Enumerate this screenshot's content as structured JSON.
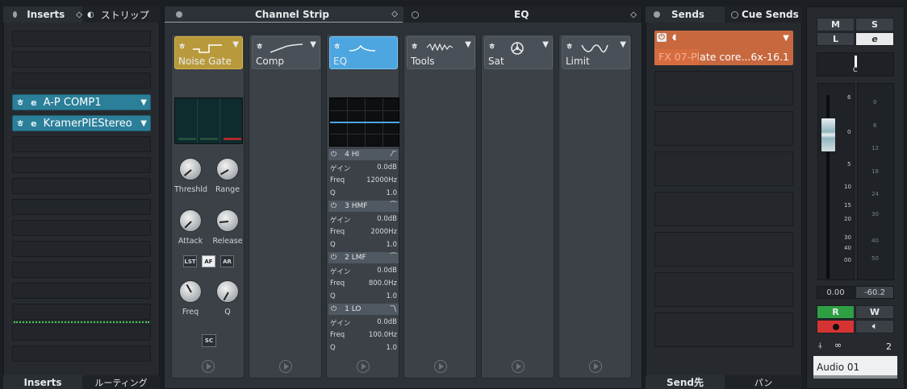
{
  "inserts": {
    "tab": "Inserts",
    "strip_tab": "ストリップ",
    "bottom_tabs": [
      "Inserts",
      "ルーティング"
    ],
    "slots": [
      {
        "label": "A-P COMP1",
        "icon": "e"
      },
      {
        "label": "KramerPIEStereo",
        "icon": "e"
      }
    ]
  },
  "channel_strip": {
    "title": "Channel Strip",
    "modules": [
      {
        "name": "Noise Gate"
      },
      {
        "name": "Comp"
      },
      {
        "name": "EQ"
      },
      {
        "name": "Tools"
      },
      {
        "name": "Sat"
      },
      {
        "name": "Limit"
      }
    ]
  },
  "eq": {
    "title": "EQ"
  },
  "gate": {
    "knobs": [
      "Threshld",
      "Range",
      "Attack",
      "Release",
      "Freq",
      "Q"
    ],
    "buttons": [
      "LST",
      "AF",
      "AR"
    ],
    "sc": "SC"
  },
  "eq_bands": [
    {
      "name": "4 HI",
      "gain_label": "ゲイン",
      "gain": "0.0dB",
      "freq_label": "Freq",
      "freq": "12000Hz",
      "q_label": "Q",
      "q": "1.0"
    },
    {
      "name": "3 HMF",
      "gain_label": "ゲイン",
      "gain": "0.0dB",
      "freq_label": "Freq",
      "freq": "2000Hz",
      "q_label": "Q",
      "q": "1.0"
    },
    {
      "name": "2 LMF",
      "gain_label": "ゲイン",
      "gain": "0.0dB",
      "freq_label": "Freq",
      "freq": "800.0Hz",
      "q_label": "Q",
      "q": "1.0"
    },
    {
      "name": "1 LO",
      "gain_label": "ゲイン",
      "gain": "0.0dB",
      "freq_label": "Freq",
      "freq": "100.0Hz",
      "q_label": "Q",
      "q": "1.0"
    }
  ],
  "sends": {
    "tab": "Sends",
    "cue_tab": "Cue Sends",
    "slot1": "FX 07-Plate core...6x",
    "slot1_level": "-16.1",
    "bottom_tabs": [
      "Send先",
      "パン"
    ]
  },
  "fader": {
    "m": "M",
    "s": "S",
    "l": "L",
    "e": "e",
    "pan": "C",
    "left_scale": [
      "6",
      "0",
      "5",
      "10",
      "15",
      "20",
      "30",
      "40",
      "00"
    ],
    "right_scale": [
      "0",
      "6",
      "12",
      "18",
      "24",
      "30",
      "40",
      "50"
    ],
    "volume": "0.00",
    "peak": "-60.2",
    "r": "R",
    "w": "W",
    "count": "2",
    "track_name": "Audio 01"
  },
  "colors": {
    "gate": "#b89a3c",
    "eq": "#4da6e0",
    "insert": "#2b7f99",
    "send": "#c7683f",
    "record": "#d63434",
    "read": "#2ea043"
  }
}
